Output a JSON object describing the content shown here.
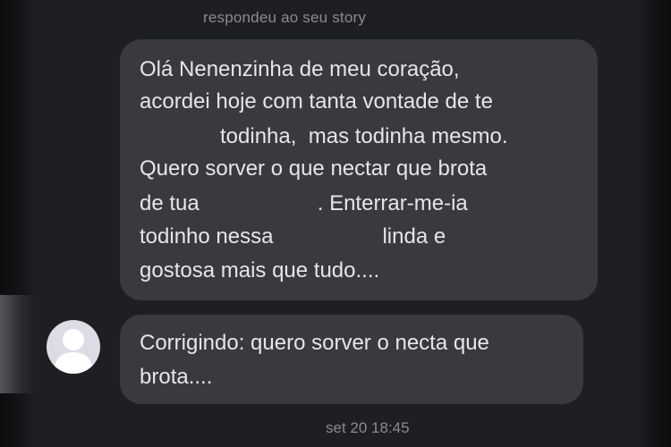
{
  "story_caption": "respondeu ao seu story",
  "message1": {
    "l1": "Olá Nenenzinha de meu coração,",
    "l2": "acordei hoje com tanta vontade de te",
    "l3": "todinha,  mas todinha mesmo.",
    "l4": "Quero sorver o que nectar que brota",
    "l5a": "de tua",
    "l5b": ". Enterrar-me-ia",
    "l6a": "todinho nessa",
    "l6b": "linda e",
    "l7": "gostosa mais que tudo...."
  },
  "message2": {
    "l1": "Corrigindo: quero sorver o necta que",
    "l2": "brota...."
  },
  "timestamp": "set 20 18:45",
  "colors": {
    "background": "#1e1f23",
    "bubble": "#3a3a3e",
    "text": "#e6e6e9",
    "meta_text": "#8b8b90",
    "avatar": "#dcdce6"
  }
}
